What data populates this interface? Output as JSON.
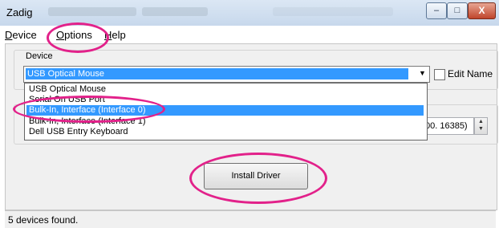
{
  "window": {
    "title": "Zadig",
    "controls": {
      "minimize": "–",
      "maximize": "□",
      "close": "X"
    }
  },
  "menu": {
    "items": [
      {
        "label": "Device",
        "mnemonic": "D"
      },
      {
        "label": "Options",
        "mnemonic": "O"
      },
      {
        "label": "Help",
        "mnemonic": "H"
      }
    ]
  },
  "device": {
    "group_label": "Device",
    "selected": "USB Optical Mouse",
    "options": [
      "USB Optical Mouse",
      "Serial On USB Port",
      "Bulk-In, Interface (Interface 0)",
      "Bulk-In, Interface (Interface 1)",
      "Dell USB Entry Keyboard"
    ],
    "highlighted_index": 2,
    "edit_name_label": "Edit Name",
    "edit_name_checked": false
  },
  "driver": {
    "device_id_value": "00. 16385)"
  },
  "actions": {
    "install_label": "Install Driver"
  },
  "status": {
    "text": "5 devices found."
  },
  "colors": {
    "highlight": "#3399ff",
    "annotation": "#e2218a"
  },
  "icons": {
    "combo_arrow": "chevron-down-icon",
    "spin_up": "spin-up-icon",
    "spin_down": "spin-down-icon"
  }
}
